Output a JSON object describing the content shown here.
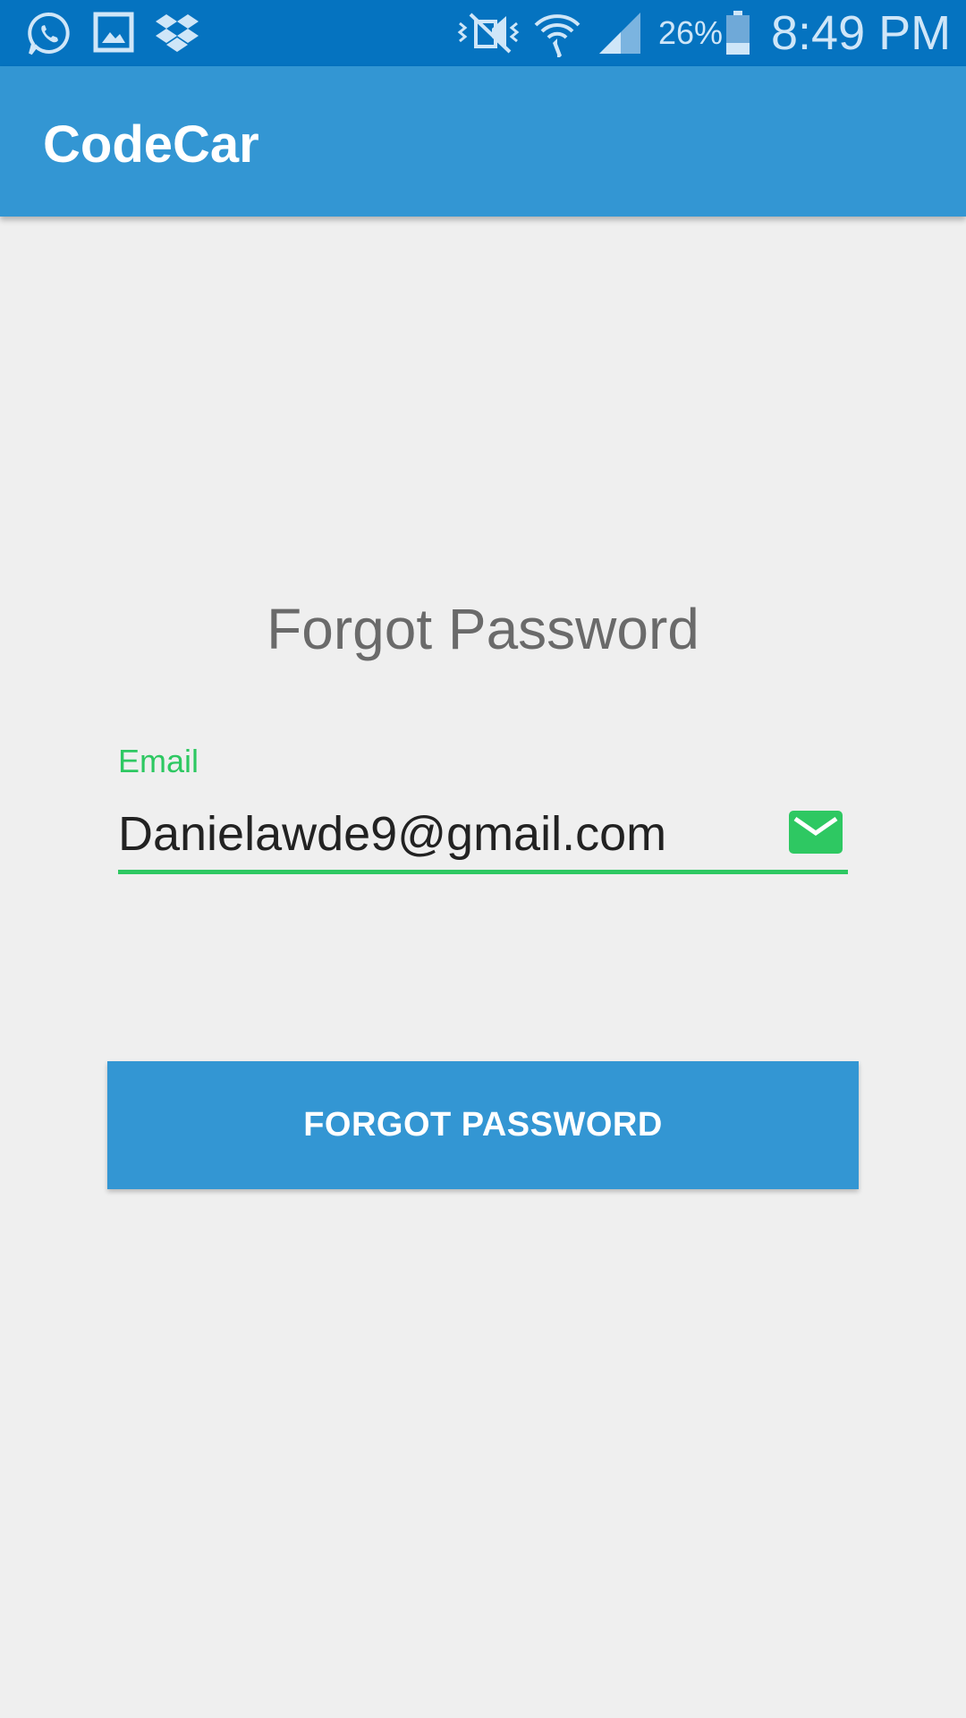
{
  "status_bar": {
    "battery_percent": "26%",
    "time": "8:49 PM",
    "icons": [
      "whatsapp-icon",
      "gallery-icon",
      "dropbox-icon",
      "vibrate-mute-icon",
      "wifi-icon",
      "signal-icon",
      "battery-icon"
    ]
  },
  "app_bar": {
    "title": "CodeCar"
  },
  "main": {
    "heading": "Forgot Password",
    "email": {
      "label": "Email",
      "value": "Danielawde9@gmail.com",
      "icon": "mail-icon"
    },
    "submit_label": "FORGOT PASSWORD"
  },
  "colors": {
    "status_bar": "#0573c0",
    "primary": "#3396d3",
    "accent": "#2ec862",
    "background": "#efefef"
  }
}
